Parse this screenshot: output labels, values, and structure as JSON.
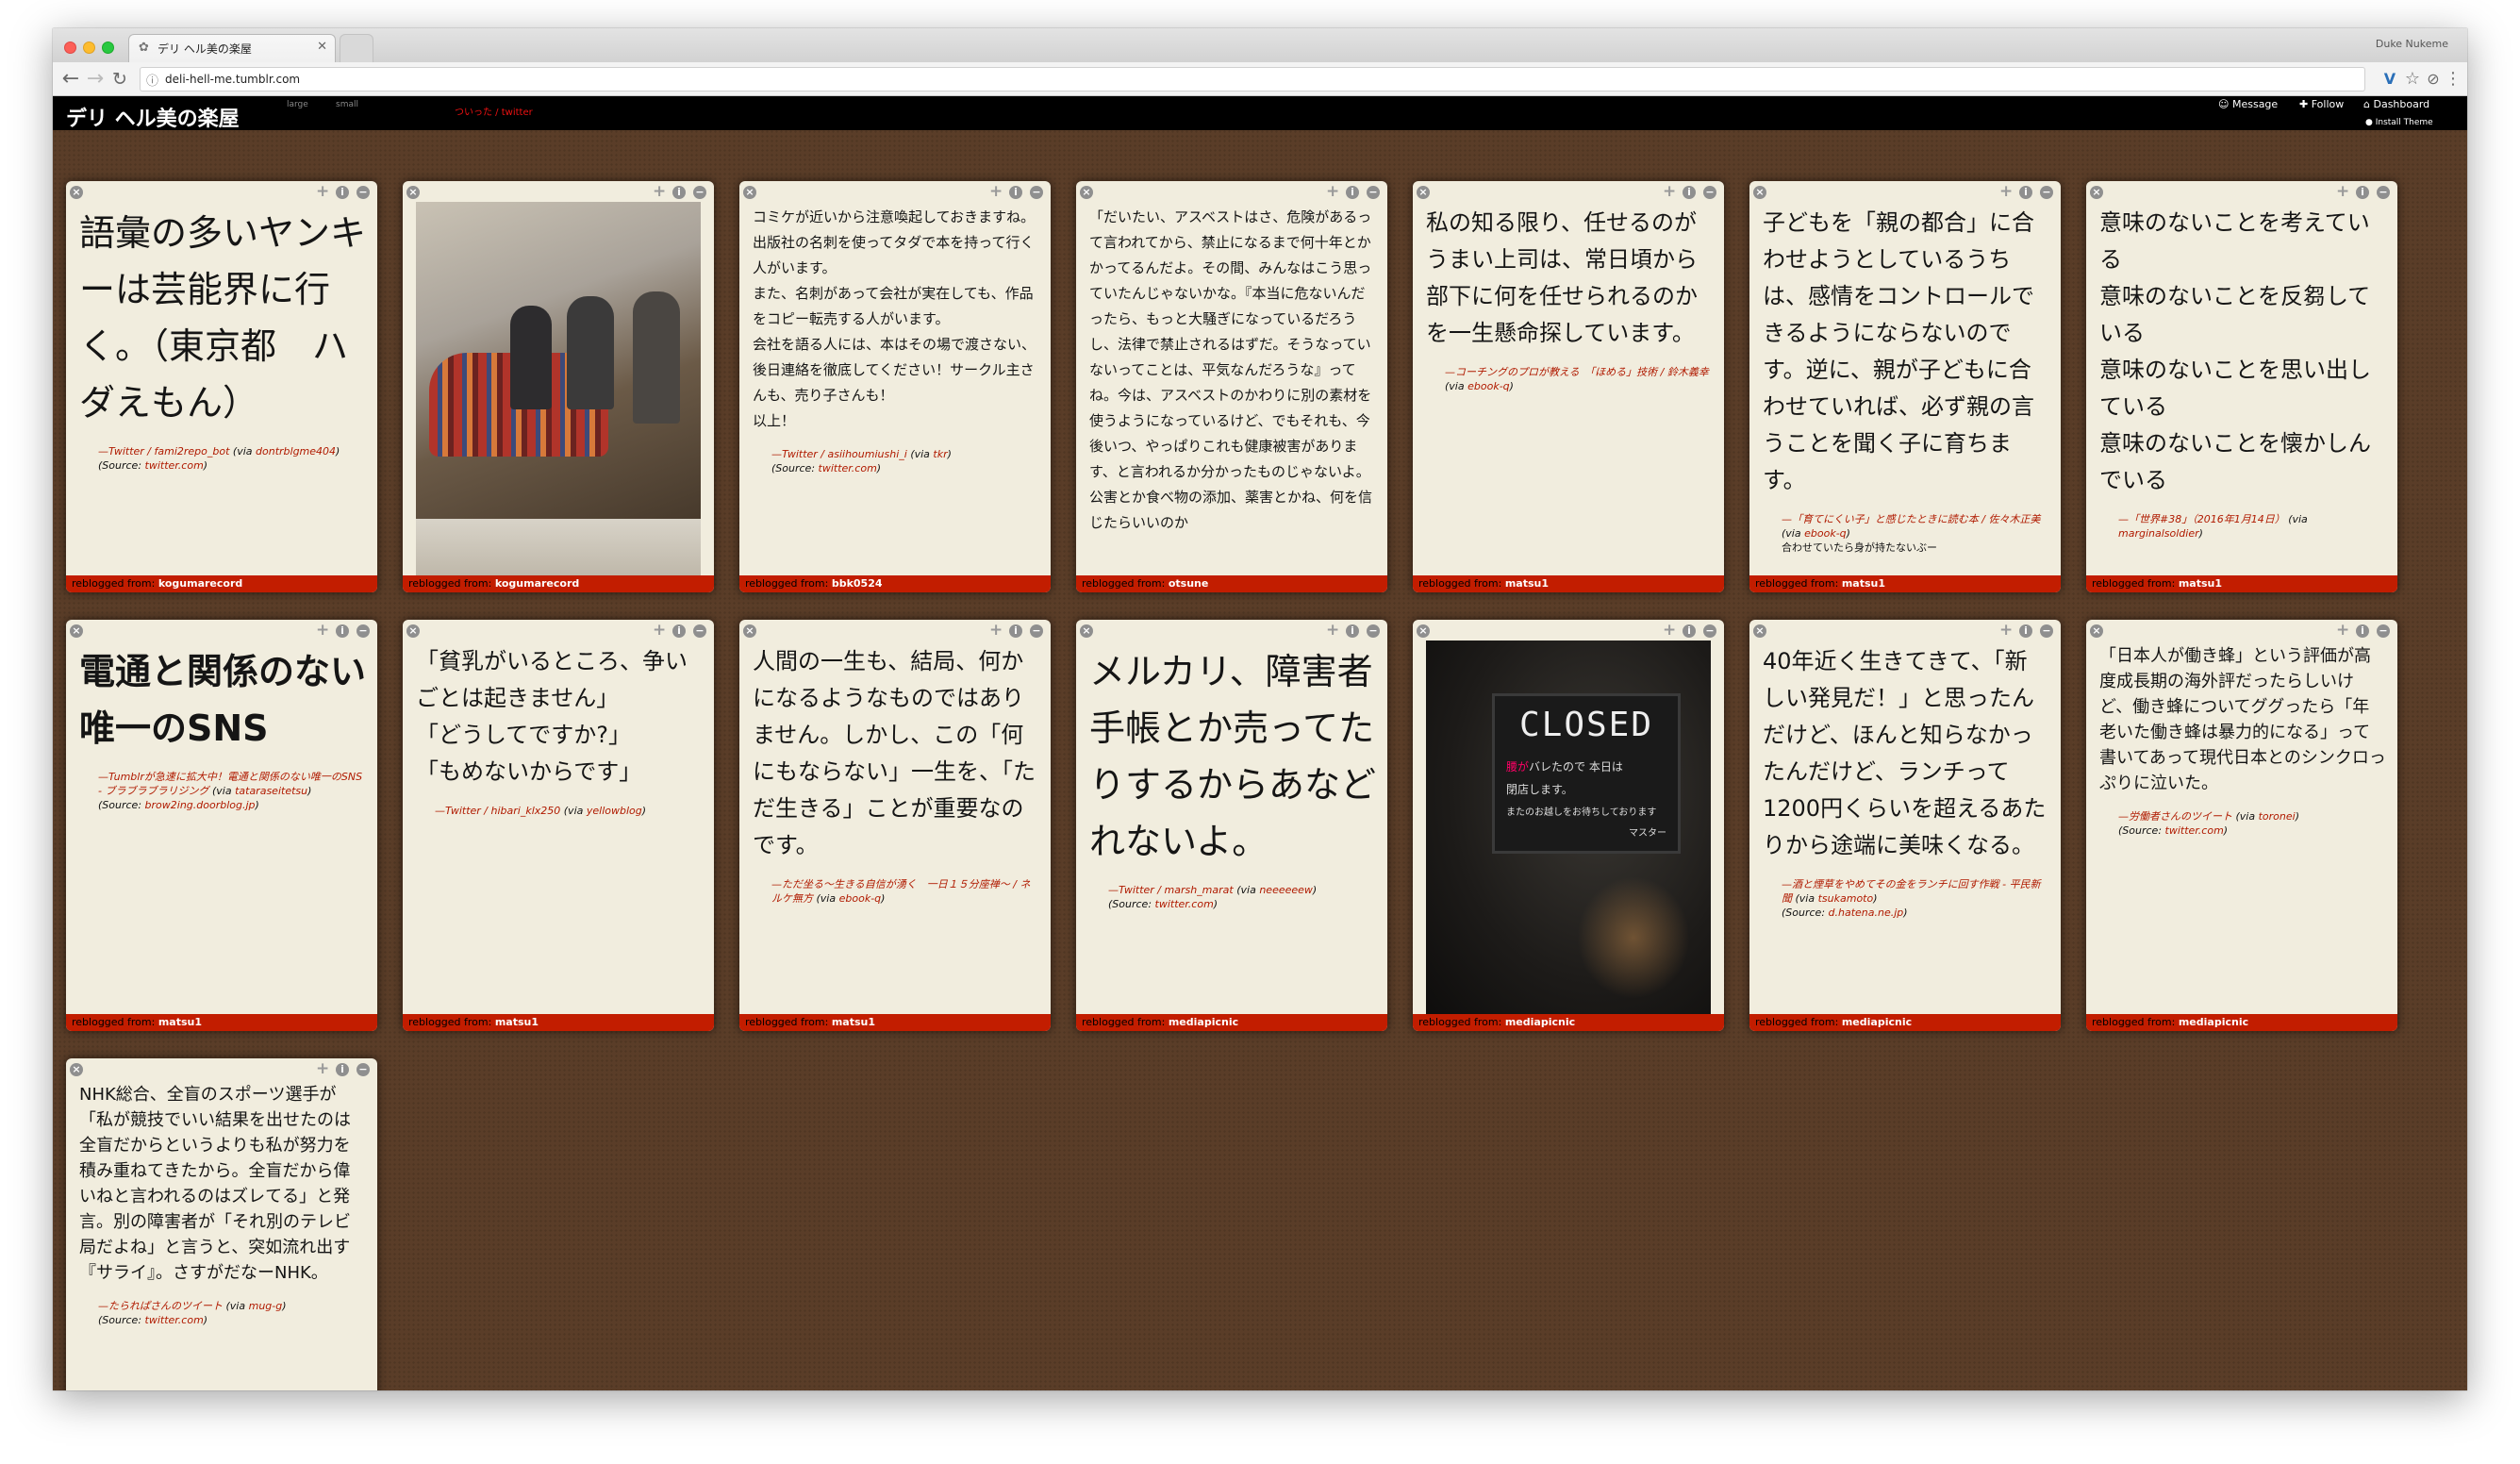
{
  "browser": {
    "tab_title": "デリ ヘル美の楽屋",
    "url": "deli-hell-me.tumblr.com",
    "user": "Duke Nukeme"
  },
  "header": {
    "title": "デリ ヘル美の楽屋",
    "large": "large",
    "small": "small",
    "twitter_link": "ついった / twitter",
    "message": "Message",
    "follow": "Follow",
    "dashboard": "Dashboard",
    "install": "Install Theme"
  },
  "cards": [
    {
      "text": "語彙の多いヤンキーは芸能界に行く。（東京都　ハダえもん）",
      "cite1": "—Twitter / fami2repo_bot",
      "via": "dontrblgme404",
      "source": "twitter.com",
      "reblog_label": "reblogged from:",
      "reblog": "kogumarecord"
    },
    {
      "reblog_label": "reblogged from:",
      "reblog": "kogumarecord"
    },
    {
      "text": "コミケが近いから注意喚起しておきますね。\n出版社の名刺を使ってタダで本を持って行く人がいます。\nまた、名刺があって会社が実在しても、作品をコピー転売する人がいます。\n会社を語る人には、本はその場で渡さない、後日連絡を徹底してください！サークル主さんも、売り子さんも！\n以上！",
      "cite1": "—Twitter / asiihoumiushi_i",
      "via": "tkr",
      "source": "twitter.com",
      "reblog_label": "reblogged from:",
      "reblog": "bbk0524"
    },
    {
      "text": "「だいたい、アスベストはさ、危険があるって言われてから、禁止になるまで何十年とかかってるんだよ。その間、みんなはこう思っていたんじゃないかな。『本当に危ないんだったら、もっと大騒ぎになっているだろうし、法律で禁止されるはずだ。そうなっていないってことは、平気なんだろうな』ってね。今は、アスベストのかわりに別の素材を使うようになっているけど、でもそれも、今後いつ、やっぱりこれも健康被害があります、と言われるか分かったものじゃないよ。公害とか食べ物の添加、薬害とかね、何を信じたらいいのか",
      "reblog_label": "reblogged from:",
      "reblog": "otsune"
    },
    {
      "text": "私の知る限り、任せるのがうまい上司は、常日頃から部下に何を任せられるのかを一生懸命探しています。",
      "cite1": "—コーチングのプロが教える　「ほめる」技術 / 鈴木義幸",
      "via": "ebook-q",
      "reblog_label": "reblogged from:",
      "reblog": "matsu1"
    },
    {
      "text": "子どもを「親の都合」に合わせようとしているうちは、感情をコントロールできるようにならないのです。逆に、親が子どもに合わせていれば、必ず親の言うことを聞く子に育ちます。",
      "cite1": "—「育てにくい子」と感じたときに読む本 / 佐々木正美",
      "via": "ebook-q",
      "note": "合わせていたら身が持たないぶー",
      "reblog_label": "reblogged from:",
      "reblog": "matsu1"
    },
    {
      "text": "意味のないことを考えている\n意味のないことを反芻している\n意味のないことを思い出している\n意味のないことを懐かしんでいる",
      "cite1": "—「世界#38」（2016年1月14日）",
      "via": "marginalsoldier",
      "reblog_label": "reblogged from:",
      "reblog": "matsu1"
    },
    {
      "text": "電通と関係のない唯一のSNS",
      "cite1": "—Tumblrが急速に拡大中！電通と関係のない唯一のSNS - ブラブラブラリジング",
      "via": "tataraseitetsu",
      "source": "brow2ing.doorblog.jp",
      "reblog_label": "reblogged from:",
      "reblog": "matsu1"
    },
    {
      "text": "「貧乳がいるところ、争いごとは起きません」\n「どうしてですか?」\n「もめないからです」",
      "cite1": "—Twitter / hibari_klx250",
      "via": "yellowblog",
      "reblog_label": "reblogged from:",
      "reblog": "matsu1"
    },
    {
      "text": "人間の一生も、結局、何かになるようなものではありません。しかし、この「何にもならない」一生を、「ただ生きる」ことが重要なのです。",
      "cite1": "—ただ坐る〜生きる自信が湧く　一日１５分座禅〜 / ネルケ無方",
      "via": "ebook-q",
      "reblog_label": "reblogged from:",
      "reblog": "matsu1"
    },
    {
      "text": "メルカリ、障害者手帳とか売ってたりするからあなどれないよ。",
      "cite1": "—Twitter / marsh_marat",
      "via": "neeeeeew",
      "source": "twitter.com",
      "reblog_label": "reblogged from:",
      "reblog": "mediapicnic"
    },
    {
      "sign_main": "CLOSED",
      "sign_sub1": "腰が",
      "sign_sub2": "バレたので 本日は",
      "sign_sub3": "閉店します。",
      "sign_sub4": "またのお越しをお待ちしております",
      "sign_sub5": "マスター",
      "reblog_label": "reblogged from:",
      "reblog": "mediapicnic"
    },
    {
      "text": "40年近く生きてきて、「新しい発見だ！」と思ったんだけど、ほんと知らなかったんだけど、ランチって1200円くらいを超えるあたりから途端に美味くなる。",
      "cite1": "—酒と煙草をやめてその金をランチに回す作戦 - 平民新聞",
      "via": "tsukamoto",
      "source": "d.hatena.ne.jp",
      "reblog_label": "reblogged from:",
      "reblog": "mediapicnic"
    },
    {
      "text": "「日本人が働き蜂」という評価が高度成長期の海外評だったらしいけど、働き蜂についてググったら「年老いた働き蜂は暴力的になる」って書いてあって現代日本とのシンクロっぷりに泣いた。",
      "cite1": "—労働者さんのツイート",
      "via": "toronei",
      "source": "twitter.com",
      "reblog_label": "reblogged from:",
      "reblog": "mediapicnic"
    },
    {
      "text": "NHK総合、全盲のスポーツ選手が「私が競技でいい結果を出せたのは全盲だからというよりも私が努力を積み重ねてきたから。全盲だから偉いねと言われるのはズレてる」と発言。別の障害者が「それ別のテレビ局だよね」と言うと、突如流れ出す『サライ』。さすがだなーNHK。",
      "cite1": "—たられぱさんのツイート",
      "via": "mug-g",
      "source": "twitter.com"
    }
  ],
  "strings": {
    "via": "(via ",
    "close": ")",
    "source": "(Source: "
  }
}
